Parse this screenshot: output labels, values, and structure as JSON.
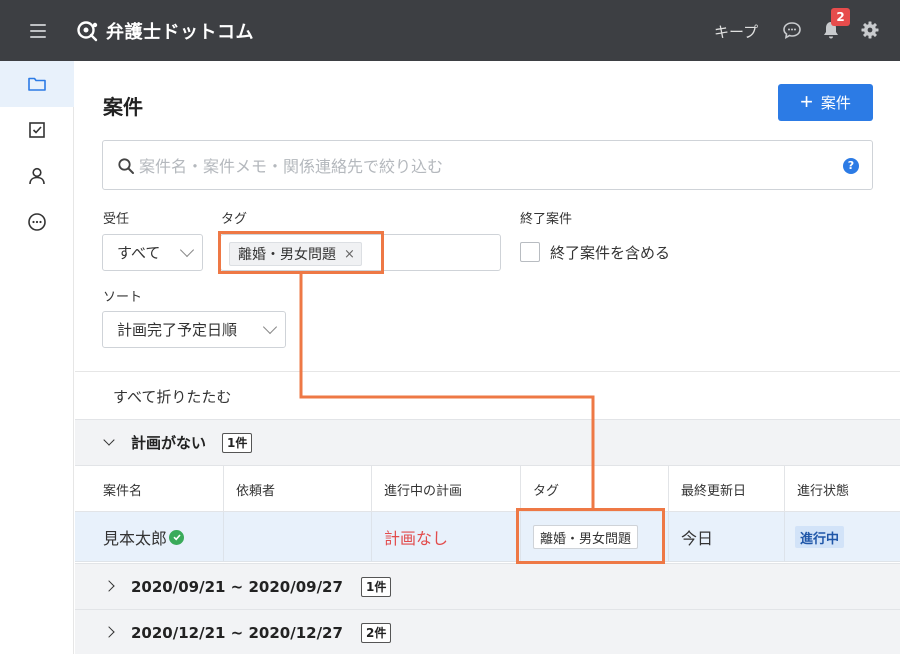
{
  "header": {
    "brand": "弁護士ドットコム",
    "keep_label": "キープ",
    "notification_count": "2"
  },
  "sidebar": {
    "items": [
      {
        "icon": "folder-icon",
        "active": true
      },
      {
        "icon": "checkbox-icon",
        "active": false
      },
      {
        "icon": "person-icon",
        "active": false
      },
      {
        "icon": "chat-bubble-icon",
        "active": false
      }
    ]
  },
  "main": {
    "title": "案件",
    "add_button_label": "案件",
    "search_placeholder": "案件名・案件メモ・関係連絡先で絞り込む",
    "help_label": "?",
    "filters": {
      "receipt_label": "受任",
      "receipt_value": "すべて",
      "tag_label": "タグ",
      "tag_chip": "離婚・男女問題",
      "tag_remove": "×",
      "closed_label": "終了案件",
      "closed_checkbox_label": "終了案件を含める",
      "sort_label": "ソート",
      "sort_value": "計画完了予定日順"
    },
    "collapse_all": "すべて折りたたむ",
    "groups": [
      {
        "title": "計画がない",
        "count": "1件",
        "expanded": true
      },
      {
        "title": "2020/09/21 ~ 2020/09/27",
        "count": "1件",
        "expanded": false
      },
      {
        "title": "2020/12/21 ~ 2020/12/27",
        "count": "2件",
        "expanded": false
      }
    ],
    "table": {
      "columns": [
        "案件名",
        "依頼者",
        "進行中の計画",
        "タグ",
        "最終更新日",
        "進行状態"
      ],
      "rows": [
        {
          "case_name": "見本太郎",
          "client": "",
          "plan": "計画なし",
          "tag": "離婚・男女問題",
          "updated": "今日",
          "status": "進行中"
        }
      ]
    }
  },
  "colors": {
    "topbar": "#3d3f43",
    "accent": "#2c7be5",
    "highlight": "#ee7845",
    "danger": "#e24c4c",
    "verified": "#3aab5a"
  }
}
